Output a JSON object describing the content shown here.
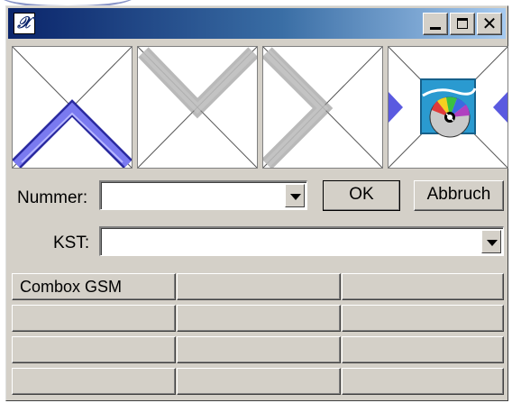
{
  "window": {
    "controls": {
      "minimize": "minimize",
      "maximize": "maximize",
      "close": "✕"
    }
  },
  "tiles": [
    {
      "name": "tile-1",
      "icon": "corner-arrow-up-blue"
    },
    {
      "name": "tile-2",
      "icon": "corner-arrow-left-gray"
    },
    {
      "name": "tile-3",
      "icon": "corner-arrow-right-gray"
    },
    {
      "name": "tile-4",
      "icon": "cd-disc-icon"
    }
  ],
  "form": {
    "nummer_label": "Nummer:",
    "nummer_value": "",
    "ok_label": "OK",
    "abbruch_label": "Abbruch",
    "kst_label": "KST:",
    "kst_value": ""
  },
  "grid": {
    "rows": [
      [
        "Combox GSM",
        "",
        ""
      ],
      [
        "",
        "",
        ""
      ],
      [
        "",
        "",
        ""
      ],
      [
        "",
        "",
        ""
      ]
    ]
  },
  "colors": {
    "titlebar_start": "#0a246a",
    "titlebar_end": "#a6caf0",
    "face": "#d4d0c8",
    "accent_blue": "#5a5ae0"
  }
}
